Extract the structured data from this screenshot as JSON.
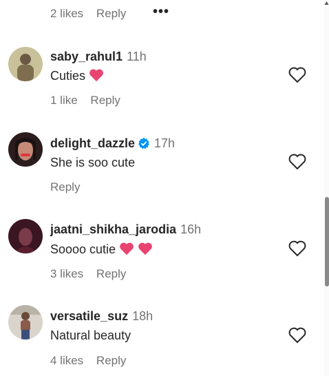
{
  "top": {
    "likes": "2 likes",
    "reply": "Reply",
    "more": "•••"
  },
  "comments": [
    {
      "username": "saby_rahul1",
      "time": "11h",
      "text": "Cuties",
      "likes": "1 like",
      "reply": "Reply"
    },
    {
      "username": "delight_dazzle",
      "time": "17h",
      "text": "She is soo cute",
      "reply": "Reply"
    },
    {
      "username": "jaatni_shikha_jarodia",
      "time": "16h",
      "text": "Soooo cutie",
      "likes": "3 likes",
      "reply": "Reply"
    },
    {
      "username": "versatile_suz",
      "time": "18h",
      "text": "Natural beauty",
      "likes": "4 likes",
      "reply": "Reply"
    }
  ],
  "colors": {
    "heart_emoji": "#e8446f",
    "verified": "#0095f6",
    "muted": "#737373"
  }
}
